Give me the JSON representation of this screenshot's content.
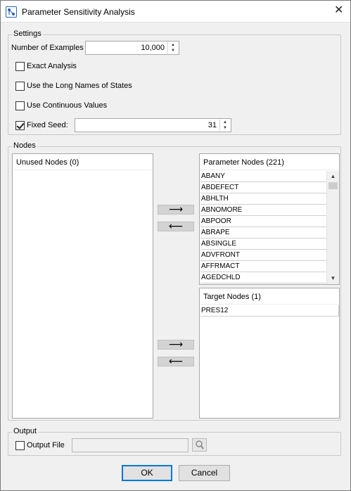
{
  "window": {
    "title": "Parameter Sensitivity Analysis",
    "close_glyph": "✕",
    "app_icon": "network-graph-icon"
  },
  "settings": {
    "legend": "Settings",
    "examples_label": "Number of Examples",
    "examples_value": "10,000",
    "exact_analysis": {
      "label": "Exact Analysis",
      "checked": false
    },
    "long_names": {
      "label": "Use the Long Names of States",
      "checked": false
    },
    "continuous": {
      "label": "Use Continuous Values",
      "checked": false
    },
    "fixed_seed": {
      "label": "Fixed Seed:",
      "checked": true,
      "value": "31"
    }
  },
  "nodes": {
    "legend": "Nodes",
    "unused_header": "Unused Nodes (0)",
    "parameter_header": "Parameter Nodes (221)",
    "parameter_items": [
      "ABANY",
      "ABDEFECT",
      "ABHLTH",
      "ABNOMORE",
      "ABPOOR",
      "ABRAPE",
      "ABSINGLE",
      "ADVFRONT",
      "AFFRMACT",
      "AGEDCHLD"
    ],
    "target_header": "Target Nodes (1)",
    "target_items": [
      "PRES12"
    ],
    "move_right_glyph": "⟶",
    "move_left_glyph": "⟵"
  },
  "output": {
    "legend": "Output",
    "output_file": {
      "label": "Output File",
      "checked": false
    },
    "file_path_value": "",
    "browse_icon": "magnifier-icon"
  },
  "buttons": {
    "ok": "OK",
    "cancel": "Cancel"
  }
}
